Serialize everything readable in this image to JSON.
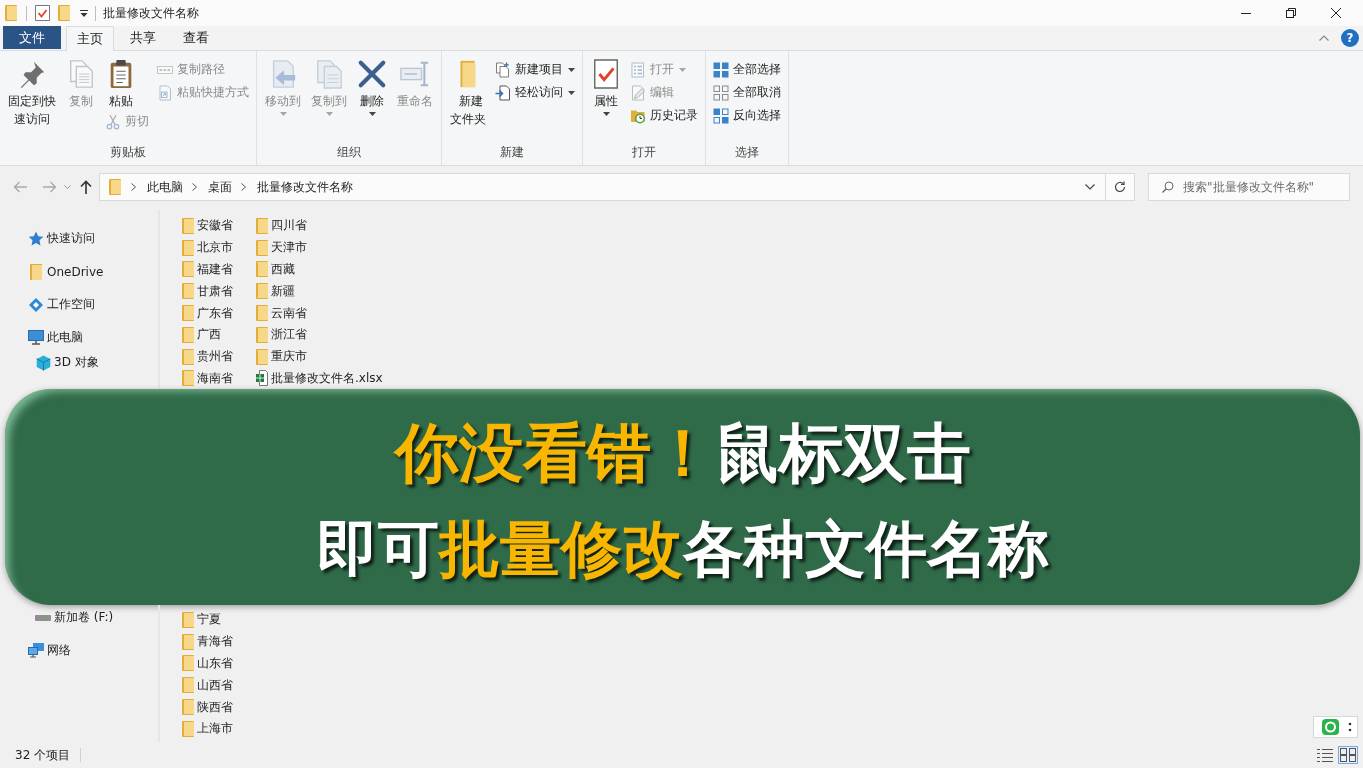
{
  "window": {
    "title": "批量修改文件名称"
  },
  "ribbon_tabs": [
    {
      "label": "文件",
      "kind": "menu",
      "selected": false
    },
    {
      "label": "主页",
      "kind": "tab",
      "selected": true
    },
    {
      "label": "共享",
      "kind": "tab",
      "selected": false
    },
    {
      "label": "查看",
      "kind": "tab",
      "selected": false
    }
  ],
  "help_button": {
    "label": "?"
  },
  "ribbon_groups": [
    {
      "label": "剪贴板",
      "columns": [
        {
          "buttons": [
            {
              "label": "固定到快速访问",
              "kind": "large",
              "disabled": false,
              "menu": false
            }
          ]
        },
        {
          "buttons": [
            {
              "label": "复制",
              "kind": "large",
              "disabled": true,
              "menu": false
            }
          ]
        },
        {
          "buttons": [
            {
              "label": "粘贴",
              "kind": "large",
              "disabled": false,
              "menu": false
            },
            {
              "label": "剪切",
              "kind": "small",
              "disabled": true,
              "menu": false
            }
          ]
        },
        {
          "buttons": [
            {
              "label": "复制路径",
              "kind": "small",
              "disabled": true,
              "menu": false
            },
            {
              "label": "粘贴快捷方式",
              "kind": "small",
              "disabled": true,
              "menu": false
            }
          ]
        }
      ]
    },
    {
      "label": "组织",
      "columns": [
        {
          "buttons": [
            {
              "label": "移动到",
              "kind": "large",
              "disabled": true,
              "menu": true
            }
          ]
        },
        {
          "buttons": [
            {
              "label": "复制到",
              "kind": "large",
              "disabled": true,
              "menu": true
            }
          ]
        },
        {
          "buttons": [
            {
              "label": "删除",
              "kind": "large",
              "disabled": false,
              "menu": true
            }
          ]
        },
        {
          "buttons": [
            {
              "label": "重命名",
              "kind": "large",
              "disabled": true,
              "menu": false
            }
          ]
        }
      ]
    },
    {
      "label": "新建",
      "columns": [
        {
          "buttons": [
            {
              "label": "新建文件夹",
              "kind": "large",
              "disabled": false,
              "menu": false
            }
          ]
        },
        {
          "buttons": [
            {
              "label": "新建项目",
              "kind": "small",
              "disabled": false,
              "menu": true
            },
            {
              "label": "轻松访问",
              "kind": "small",
              "disabled": false,
              "menu": true
            }
          ]
        }
      ]
    },
    {
      "label": "打开",
      "columns": [
        {
          "buttons": [
            {
              "label": "属性",
              "kind": "large",
              "disabled": false,
              "menu": true
            }
          ]
        },
        {
          "buttons": [
            {
              "label": "打开",
              "kind": "small",
              "disabled": true,
              "menu": true
            },
            {
              "label": "编辑",
              "kind": "small",
              "disabled": true,
              "menu": false
            },
            {
              "label": "历史记录",
              "kind": "small",
              "disabled": false,
              "menu": false
            }
          ]
        }
      ]
    },
    {
      "label": "选择",
      "columns": [
        {
          "buttons": [
            {
              "label": "全部选择",
              "kind": "small",
              "disabled": false,
              "menu": false
            },
            {
              "label": "全部取消",
              "kind": "small",
              "disabled": false,
              "menu": false
            },
            {
              "label": "反向选择",
              "kind": "small",
              "disabled": false,
              "menu": false
            }
          ]
        }
      ]
    }
  ],
  "address_bar": {
    "breadcrumbs": [
      "此电脑",
      "桌面",
      "批量修改文件名称"
    ]
  },
  "search": {
    "placeholder": "搜索\"批量修改文件名称\""
  },
  "above_banner": {
    "navigation": {
      "items": [
        {
          "label": "快速访问",
          "selected": false
        },
        {
          "label": "OneDrive",
          "selected": false
        },
        {
          "label": "工作空间",
          "selected": false
        },
        {
          "label": "此电脑",
          "selected": false,
          "children": [
            {
              "label": "3D 对象",
              "selected": false
            }
          ]
        }
      ]
    },
    "files": [
      {
        "name": "安徽省",
        "kind": "folder"
      },
      {
        "name": "北京市",
        "kind": "folder"
      },
      {
        "name": "福建省",
        "kind": "folder"
      },
      {
        "name": "甘肃省",
        "kind": "folder"
      },
      {
        "name": "广东省",
        "kind": "folder"
      },
      {
        "name": "广西",
        "kind": "folder"
      },
      {
        "name": "贵州省",
        "kind": "folder"
      },
      {
        "name": "海南省",
        "kind": "folder"
      },
      {
        "name": "四川省",
        "kind": "folder"
      },
      {
        "name": "天津市",
        "kind": "folder"
      },
      {
        "name": "西藏",
        "kind": "folder"
      },
      {
        "name": "新疆",
        "kind": "folder"
      },
      {
        "name": "云南省",
        "kind": "folder"
      },
      {
        "name": "浙江省",
        "kind": "folder"
      },
      {
        "name": "重庆市",
        "kind": "folder"
      },
      {
        "name": "批量修改文件名.xlsx",
        "kind": "spreadsheet"
      }
    ]
  },
  "banner": {
    "lines": [
      {
        "segments": [
          {
            "text": "你没看错！",
            "highlighted": true
          },
          {
            "text": "鼠标双击",
            "highlighted": false
          }
        ]
      },
      {
        "segments": [
          {
            "text": "即可",
            "highlighted": false
          },
          {
            "text": "批量修改",
            "highlighted": true
          },
          {
            "text": "各种文件名称",
            "highlighted": false
          }
        ]
      }
    ]
  },
  "below_banner": {
    "navigation": {
      "items": [
        {
          "children": [
            {
              "label": "新加卷 (F:)",
              "selected": false
            }
          ]
        },
        {
          "label": "网络",
          "selected": false
        }
      ]
    },
    "files": [
      {
        "name": "宁夏",
        "kind": "folder"
      },
      {
        "name": "青海省",
        "kind": "folder"
      },
      {
        "name": "山东省",
        "kind": "folder"
      },
      {
        "name": "山西省",
        "kind": "folder"
      },
      {
        "name": "陕西省",
        "kind": "folder"
      },
      {
        "name": "上海市",
        "kind": "folder"
      }
    ]
  },
  "status_bar": {
    "item_count": "32 个项目",
    "views": [
      {
        "selected": false
      },
      {
        "selected": true
      }
    ]
  }
}
